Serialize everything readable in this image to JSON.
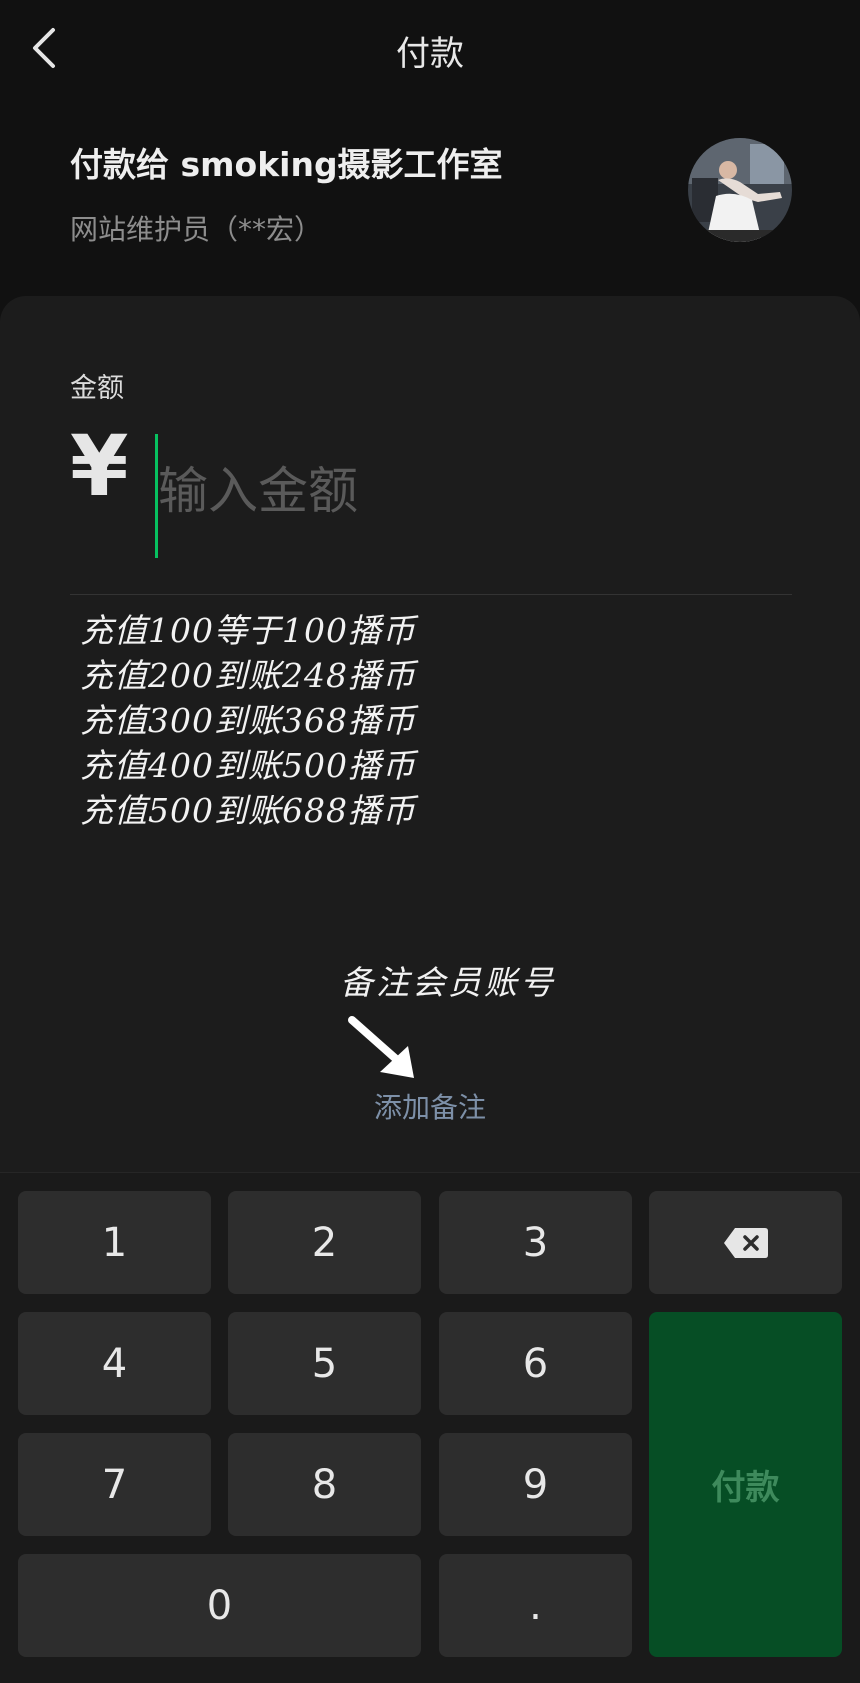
{
  "header": {
    "title": "付款",
    "back_icon": "chevron-left-icon"
  },
  "payee": {
    "name": "付款给 smoking摄影工作室",
    "subtitle": "网站维护员（**宏）"
  },
  "amount": {
    "label": "金额",
    "currency_symbol": "¥",
    "placeholder": "输入金额",
    "value": ""
  },
  "promo": {
    "lines": [
      "充值100等于100播币",
      "充值200到账248播币",
      "充值300到账368播币",
      "充值400到账500播币",
      "充值500到账688播币"
    ]
  },
  "annotation": {
    "text": "备注会员账号"
  },
  "note": {
    "label": "添加备注"
  },
  "keypad": {
    "keys": [
      "1",
      "2",
      "3",
      "4",
      "5",
      "6",
      "7",
      "8",
      "9",
      "0",
      "."
    ],
    "delete_icon": "backspace-icon",
    "pay_label": "付款"
  },
  "colors": {
    "background": "#111111",
    "card": "#1c1c1c",
    "caret": "#07c160",
    "link": "#7d90a8",
    "pay_button": "#064e25",
    "pay_text": "#3e8a5c"
  }
}
